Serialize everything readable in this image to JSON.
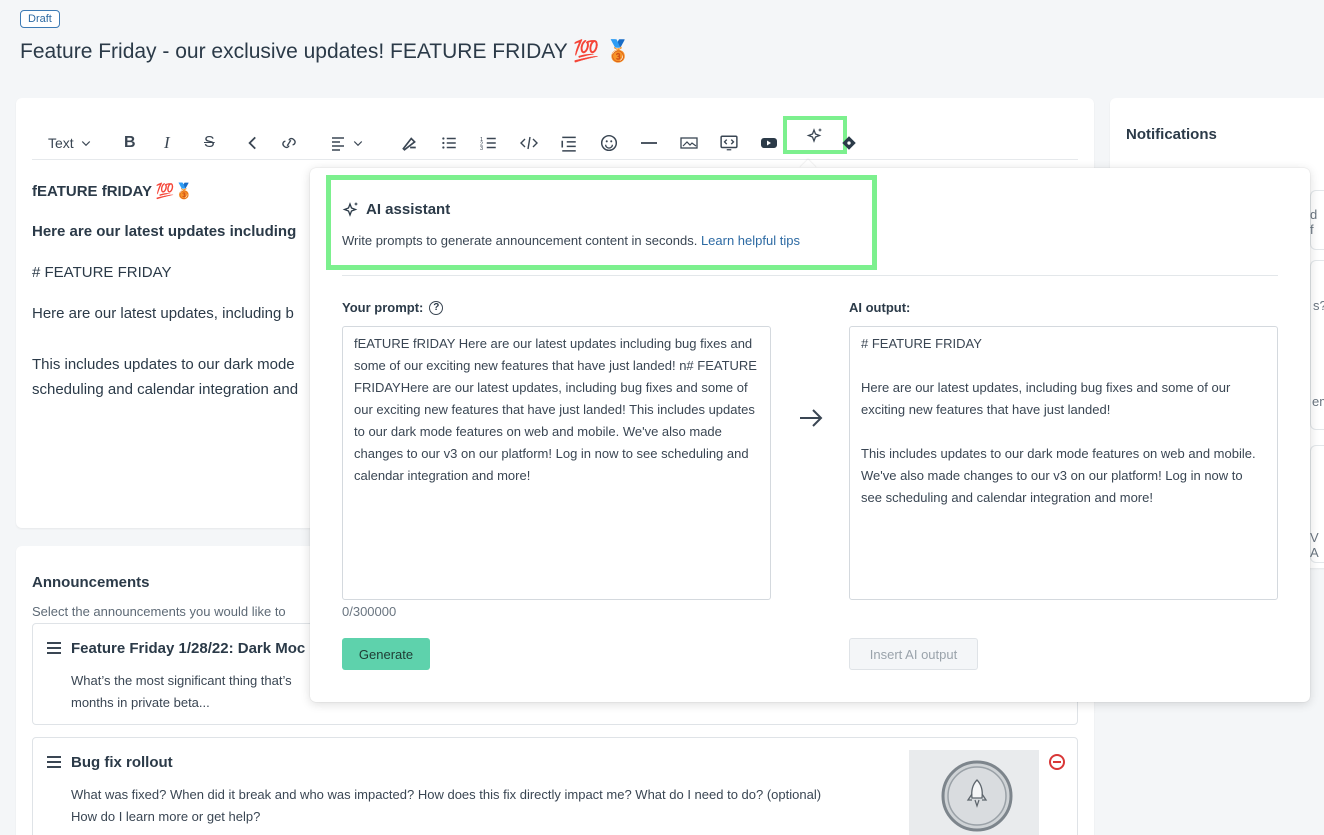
{
  "header": {
    "status_badge": "Draft",
    "page_title": "Feature Friday - our exclusive updates! FEATURE FRIDAY 💯 🥉"
  },
  "toolbar": {
    "text_style": "Text",
    "icons": [
      "bold-icon",
      "italic-icon",
      "strikethrough-icon",
      "back-icon",
      "link-icon",
      "align-icon",
      "clear-format-icon",
      "bullet-list-icon",
      "numbered-list-icon",
      "code-icon",
      "indent-icon",
      "emoji-icon",
      "horizontal-rule-icon",
      "image-icon",
      "embed-icon",
      "youtube-icon",
      "ai-sparkle-icon",
      "diamond-icon"
    ]
  },
  "editor": {
    "line1": "fEATURE fRIDAY 💯🥉",
    "line2": "Here are our latest updates including",
    "line3": "# FEATURE FRIDAY",
    "line4": "Here are our latest updates, including b",
    "line5": "This includes updates to our dark mode",
    "line6": "scheduling and calendar integration and"
  },
  "notifications": {
    "title": "Notifications",
    "frag1": "d f",
    "frag2": "s?",
    "frag3": "em",
    "frag4": "V A"
  },
  "announcements": {
    "title": "Announcements",
    "subtitle": "Select the announcements you would like to",
    "items": [
      {
        "title": "Feature Friday 1/28/22: Dark Moc",
        "body": "What’s the most significant thing that’s",
        "body2": "months in private beta..."
      },
      {
        "title": "Bug fix rollout",
        "body": "What was fixed? When did it break and who was impacted? How does this fix directly impact me? What do I need to do? (optional)",
        "body2": "How do I learn more or get help?"
      }
    ]
  },
  "ai_assistant": {
    "title": "AI assistant",
    "description": "Write prompts to generate announcement content in seconds.",
    "tips_link": "Learn helpful tips",
    "prompt_label": "Your prompt:",
    "prompt_text": "fEATURE fRIDAY Here are our latest updates including bug fixes and some of our exciting new features that have just landed! n# FEATURE FRIDAYHere are our latest updates, including bug fixes and some of our exciting new features that have just landed! This includes updates to our dark mode features on web and mobile. We've also made changes to our v3 on our platform! Log in now to see scheduling and calendar integration and more!",
    "char_count": "0/300000",
    "output_label": "AI output:",
    "output_text": "# FEATURE FRIDAY\n\nHere are our latest updates, including bug fixes and some of our exciting new features that have just landed!\n\nThis includes updates to our dark mode features on web and mobile. We've also made changes to our v3 on our platform! Log in now to see scheduling and calendar integration and more!",
    "generate_button": "Generate",
    "insert_button": "Insert AI output"
  },
  "colors": {
    "highlight": "#7cf08e",
    "generate": "#5ed2ac",
    "link": "#2d6aa3"
  }
}
